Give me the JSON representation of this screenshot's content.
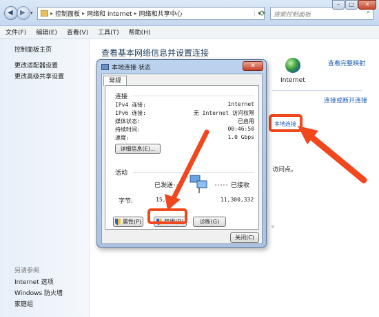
{
  "address": {
    "crumbs": [
      "控制面板",
      "网络和 Internet",
      "网络和共享中心"
    ],
    "search_placeholder": "搜索控制面板"
  },
  "menu": [
    "文件(F)",
    "编辑(E)",
    "查看(V)",
    "工具(T)",
    "帮助(H)"
  ],
  "left_nav": {
    "links": [
      "控制面板主页",
      "更改适配器设置",
      "更改高级共享设置"
    ],
    "see_also_title": "另请参阅",
    "see_also": [
      "Internet 选项",
      "Windows 防火墙",
      "家庭组"
    ]
  },
  "main": {
    "title": "查看基本网络信息并设置连接",
    "full_map_link": "查看完整映射",
    "internet_label": "Internet",
    "connect_link": "连接或断开连接",
    "local_conn_link": "本地连接",
    "fragment_access": "访问点。",
    "fragment_dot": "。"
  },
  "dialog": {
    "title": "本地连接 状态",
    "tab": "常规",
    "connection_section": "连接",
    "rows": [
      {
        "label": "IPv4 连接:",
        "value": "Internet"
      },
      {
        "label": "IPv6 连接:",
        "value": "无 Internet 访问权限"
      },
      {
        "label": "媒体状态:",
        "value": "已启用"
      },
      {
        "label": "持续时间:",
        "value": "00:46:50"
      },
      {
        "label": "速度:",
        "value": "1.0 Gbps"
      }
    ],
    "details_button": "详细信息(E)...",
    "activity_section": "活动",
    "sent_label": "已发送",
    "received_label": "已接收",
    "bytes_label": "字节:",
    "bytes_sent": "15,60",
    "bytes_received": "11,300,332",
    "properties_button": "属性(P)",
    "disable_button": "禁用(D)",
    "diagnose_button": "诊断(G)",
    "close_button": "关闭(C)"
  },
  "colors": {
    "highlight": "#f0471d",
    "link": "#1a5bb5"
  }
}
